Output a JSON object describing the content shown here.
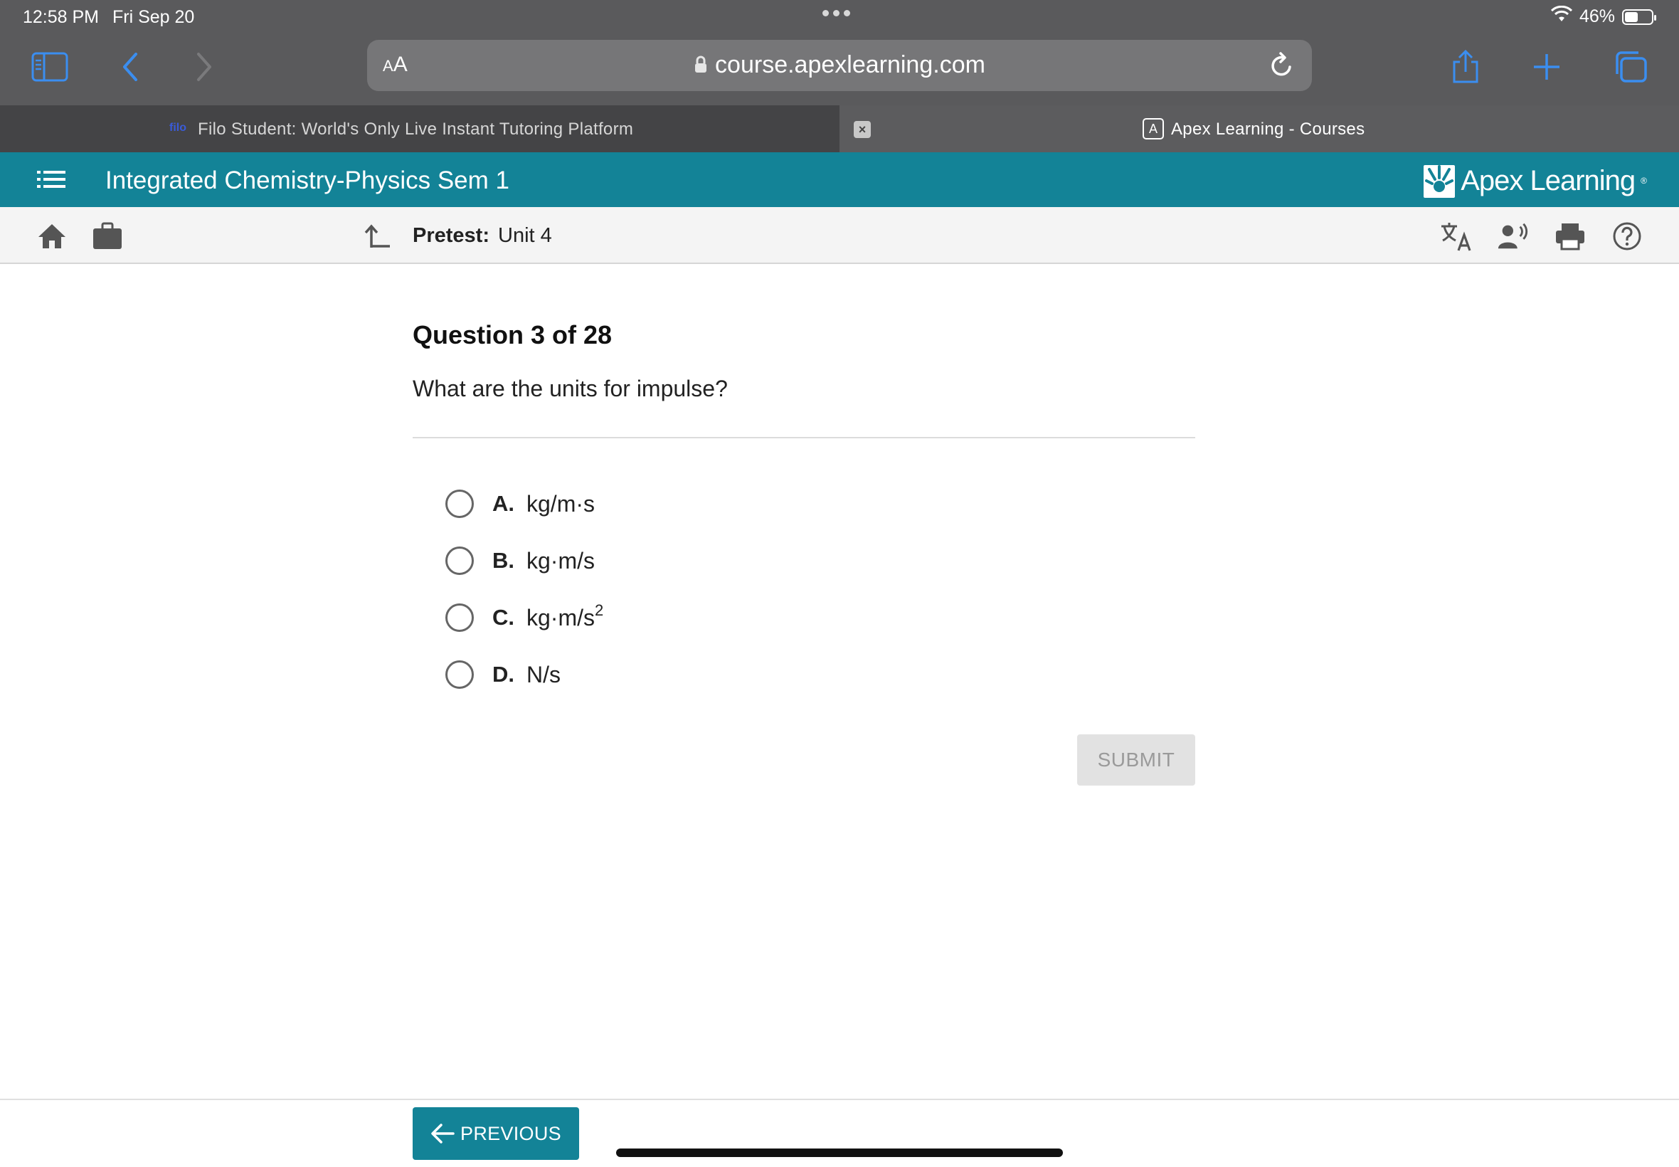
{
  "status_bar": {
    "time": "12:58 PM",
    "date": "Fri Sep 20",
    "battery": "46%"
  },
  "browser": {
    "aa_label_small": "A",
    "aa_label": "A",
    "url": "course.apexlearning.com"
  },
  "tabs": [
    {
      "favicon": "filo",
      "title": "Filo Student: World's Only Live Instant Tutoring Platform",
      "active": false
    },
    {
      "favicon": "A",
      "title": "Apex Learning - Courses",
      "active": true
    }
  ],
  "header": {
    "course_title": "Integrated Chemistry-Physics Sem 1",
    "logo_text": "Apex Learning",
    "logo_mark": "®"
  },
  "subbar": {
    "label": "Pretest:",
    "unit": "Unit 4"
  },
  "question": {
    "number": "Question 3 of 28",
    "text": "What are the units for impulse?",
    "options": [
      {
        "letter": "A.",
        "text": "kg/m·s",
        "sup": ""
      },
      {
        "letter": "B.",
        "text": "kg·m/s",
        "sup": ""
      },
      {
        "letter": "C.",
        "text": "kg·m/s",
        "sup": "2"
      },
      {
        "letter": "D.",
        "text": "N/s",
        "sup": ""
      }
    ]
  },
  "submit_label": "SUBMIT",
  "previous_label": "PREVIOUS",
  "colors": {
    "accent": "#138397",
    "chrome": "#5a5a5c",
    "ios_blue": "#3b8ef0"
  }
}
